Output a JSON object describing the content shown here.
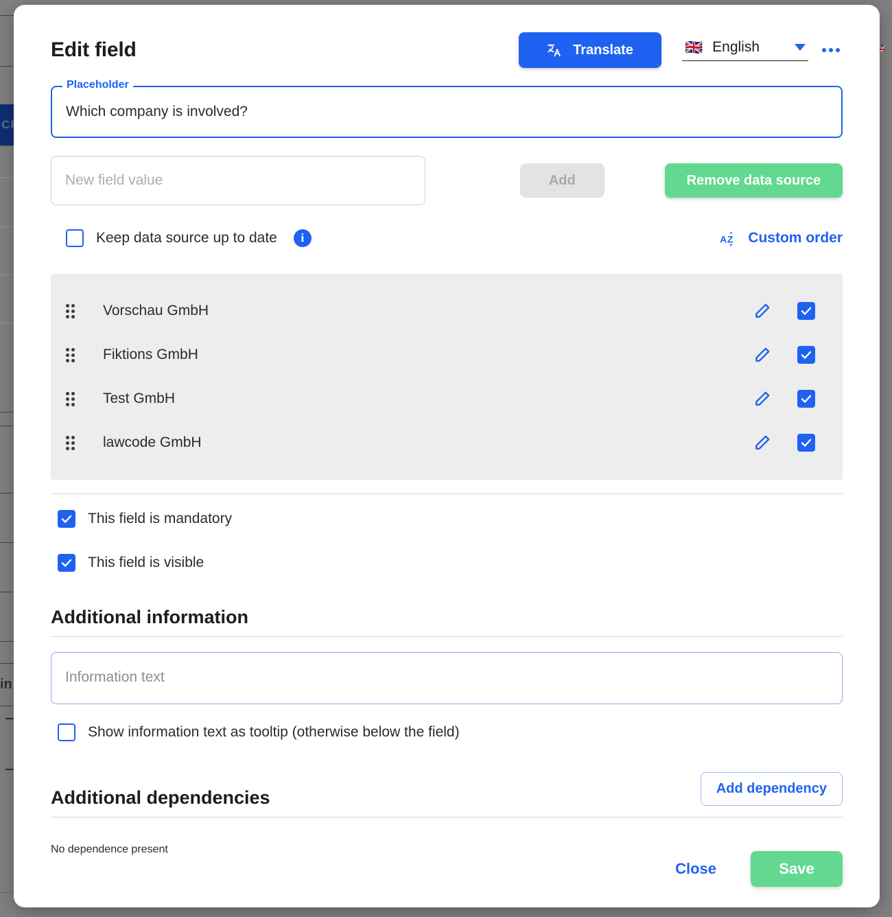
{
  "modal": {
    "title": "Edit field",
    "header": {
      "translate_label": "Translate",
      "translate_icon": "translate-icon",
      "language_flag": "🇬🇧",
      "language_name": "English",
      "dropdown_icon": "chevron-down-icon",
      "more_icon": "kebab-menu-icon"
    },
    "placeholder_field": {
      "legend": "Placeholder",
      "value": "Which company is involved?"
    },
    "new_value_field": {
      "placeholder": "New field value",
      "value": ""
    },
    "buttons": {
      "add": "Add",
      "remove_data_source": "Remove data source",
      "add_dependency": "Add dependency",
      "close": "Close",
      "save": "Save"
    },
    "keep_up_to_date": {
      "label": "Keep data source up to date",
      "checked": false,
      "info_icon": "info-icon",
      "info_glyph": "i"
    },
    "custom_order": {
      "label": "Custom order",
      "icon": "sort-alpha-icon"
    },
    "list_items": [
      {
        "label": "Vorschau GmbH",
        "checked": true
      },
      {
        "label": "Fiktions GmbH",
        "checked": true
      },
      {
        "label": "Test GmbH",
        "checked": true
      },
      {
        "label": "lawcode GmbH",
        "checked": true
      }
    ],
    "flags": [
      {
        "label": "This field is mandatory",
        "checked": true
      },
      {
        "label": "This field is visible",
        "checked": true
      }
    ],
    "additional_information": {
      "title": "Additional information",
      "textarea_placeholder": "Information text",
      "textarea_value": "",
      "tooltip_checkbox_label": "Show information text as tooltip (otherwise below the field)",
      "tooltip_checked": false
    },
    "additional_dependencies": {
      "title": "Additional dependencies",
      "empty_text": "No dependence present"
    }
  },
  "background": {
    "nav_text": "CF"
  },
  "colors": {
    "primary_blue": "#1f62f2",
    "success_green": "#62d890",
    "disabled_gray": "#e3e3e3",
    "list_bg": "#ededed",
    "overlay": "#808080"
  }
}
